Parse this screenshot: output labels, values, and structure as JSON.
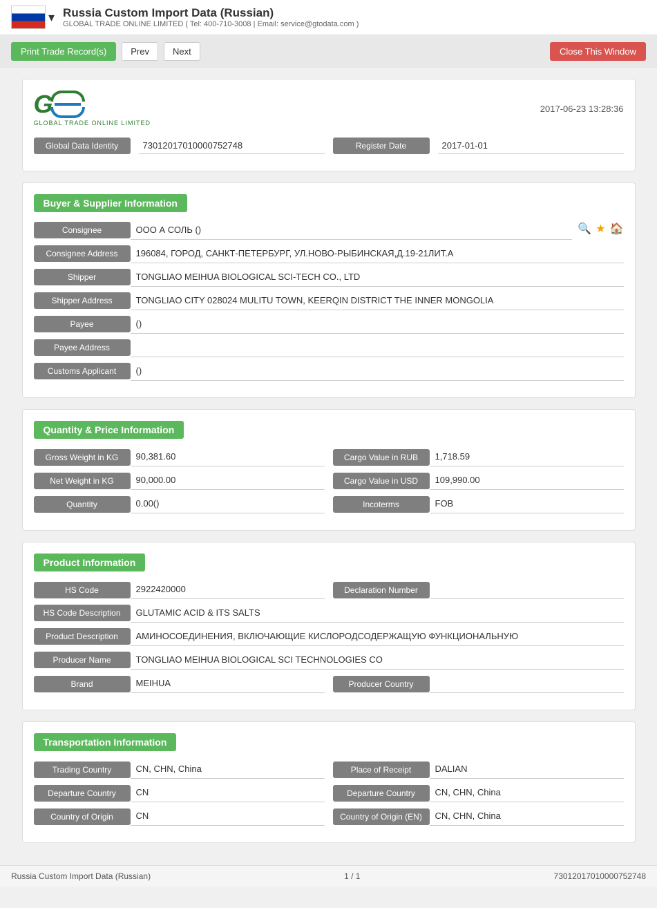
{
  "header": {
    "title": "Russia Custom Import Data (Russian)",
    "subtitle": "GLOBAL TRADE ONLINE LIMITED ( Tel: 400-710-3008 | Email: service@gtodata.com )"
  },
  "toolbar": {
    "print_label": "Print Trade Record(s)",
    "prev_label": "Prev",
    "next_label": "Next",
    "close_label": "Close This Window"
  },
  "record": {
    "timestamp": "2017-06-23 13:28:36",
    "global_data_identity_label": "Global Data Identity",
    "global_data_identity_value": "73012017010000752748",
    "register_date_label": "Register Date",
    "register_date_value": "2017-01-01"
  },
  "buyer_supplier": {
    "section_title": "Buyer & Supplier Information",
    "fields": [
      {
        "label": "Consignee",
        "value": "ООО А СОЛЬ ()"
      },
      {
        "label": "Consignee Address",
        "value": "196084, ГОРОД, САНКТ-ПЕТЕРБУРГ, УЛ.НОВО-РЫБИНСКАЯ,Д.19-21ЛИТ.А"
      },
      {
        "label": "Shipper",
        "value": "TONGLIAO MEIHUA BIOLOGICAL SCI-TECH CO., LTD"
      },
      {
        "label": "Shipper Address",
        "value": "TONGLIAO CITY 028024 MULITU TOWN, KEERQIN DISTRICT THE INNER MONGOLIA"
      },
      {
        "label": "Payee",
        "value": "()"
      },
      {
        "label": "Payee Address",
        "value": ""
      },
      {
        "label": "Customs Applicant",
        "value": "()"
      }
    ]
  },
  "quantity_price": {
    "section_title": "Quantity & Price Information",
    "left_fields": [
      {
        "label": "Gross Weight in KG",
        "value": "90,381.60"
      },
      {
        "label": "Net Weight in KG",
        "value": "90,000.00"
      },
      {
        "label": "Quantity",
        "value": "0.00()"
      }
    ],
    "right_fields": [
      {
        "label": "Cargo Value in RUB",
        "value": "1,718.59"
      },
      {
        "label": "Cargo Value in USD",
        "value": "109,990.00"
      },
      {
        "label": "Incoterms",
        "value": "FOB"
      }
    ]
  },
  "product": {
    "section_title": "Product Information",
    "hs_code_label": "HS Code",
    "hs_code_value": "2922420000",
    "declaration_number_label": "Declaration Number",
    "declaration_number_value": "",
    "hs_desc_label": "HS Code Description",
    "hs_desc_value": "GLUTAMIC ACID & ITS SALTS",
    "product_desc_label": "Product Description",
    "product_desc_value": "АМИНОСОЕДИНЕНИЯ, ВКЛЮЧАЮЩИЕ КИСЛОРОДСОДЕРЖАЩУЮ ФУНКЦИОНАЛЬНУЮ",
    "producer_name_label": "Producer Name",
    "producer_name_value": "TONGLIAO MEIHUA BIOLOGICAL SCI TECHNOLOGIES CO",
    "brand_label": "Brand",
    "brand_value": "MEIHUA",
    "producer_country_label": "Producer Country",
    "producer_country_value": ""
  },
  "transportation": {
    "section_title": "Transportation Information",
    "trading_country_label": "Trading Country",
    "trading_country_value": "CN, CHN, China",
    "place_of_receipt_label": "Place of Receipt",
    "place_of_receipt_value": "DALIAN",
    "departure_country_left_label": "Departure Country",
    "departure_country_left_value": "CN",
    "departure_country_right_label": "Departure Country",
    "departure_country_right_value": "CN, CHN, China",
    "country_of_origin_label": "Country of Origin",
    "country_of_origin_value": "CN",
    "country_of_origin_en_label": "Country of Origin (EN)",
    "country_of_origin_en_value": "CN, CHN, China"
  },
  "footer": {
    "left_text": "Russia Custom Import Data (Russian)",
    "center_text": "1 / 1",
    "right_text": "73012017010000752748"
  }
}
